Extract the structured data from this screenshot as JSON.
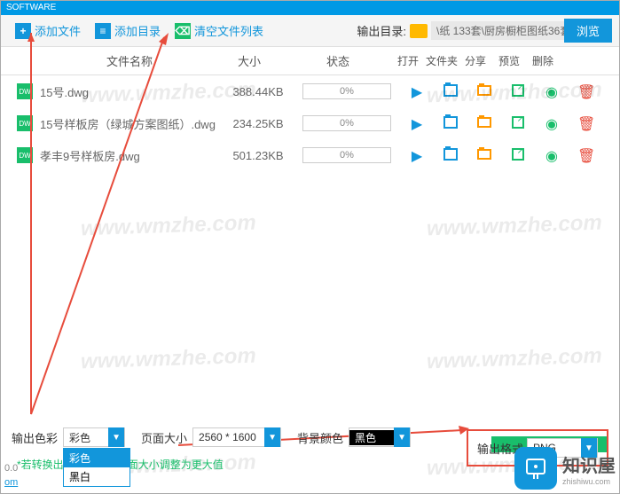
{
  "title": "SOFTWARE",
  "toolbar": {
    "add_file": "添加文件",
    "add_dir": "添加目录",
    "clear_list": "清空文件列表",
    "output_dir_label": "输出目录:",
    "output_path": "\\纸 133套\\厨房橱柜图纸36套",
    "browse": "浏览"
  },
  "headers": {
    "name": "文件名称",
    "size": "大小",
    "status": "状态",
    "open": "打开",
    "folder": "文件夹",
    "share": "分享",
    "preview": "预览",
    "delete": "删除"
  },
  "rows": [
    {
      "name": "15号.dwg",
      "thumb": "DW",
      "size": "388.44KB",
      "progress": "0%"
    },
    {
      "name": "15号样板房（绿城方案图纸）.dwg",
      "thumb": "DW",
      "size": "234.25KB",
      "progress": "0%"
    },
    {
      "name": "孝丰9号样板房.dwg",
      "thumb": "DW",
      "size": "501.23KB",
      "progress": "0%"
    }
  ],
  "options": {
    "color_label": "输出色彩",
    "color_value": "彩色",
    "color_items": [
      "彩色",
      "黑白"
    ],
    "page_label": "页面大小",
    "page_value": "2560 * 1600",
    "bg_label": "背景颜色",
    "bg_value": "黑色",
    "format_label": "输出格式",
    "format_value": "PNG"
  },
  "hint": "*若转换出来的",
  "hint2": "面大小调整为更大值",
  "watermark": "www.wmzhe.com",
  "logo": {
    "cn": "知识屋",
    "en": "zhishiwu.com"
  },
  "bottom": {
    "link": "om",
    "num": "0.0"
  }
}
